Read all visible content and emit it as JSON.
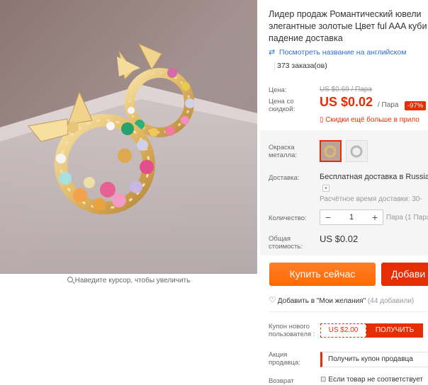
{
  "product": {
    "title_lines": [
      "Лидер продаж Романтический ювели",
      "элегантные золотые Цвет ful AAA куби",
      "падение доставка"
    ],
    "translate_link": "Посмотреть название на английском",
    "orders": "373 заказа(ов)",
    "zoom_hint": "Наведите курсор, чтобы увеличить"
  },
  "pricing": {
    "price_label": "Цена:",
    "old_price": "US $0.69 / Пара",
    "discount_price_label": "Цена со скидкой:",
    "discount_price": "US $0.02",
    "per_unit": "/ Пара",
    "discount_badge": "-97%",
    "app_discount": "Скидки ещё больше в прило"
  },
  "options": {
    "color_label": "Окраска металла:",
    "swatches": [
      {
        "name": "gold",
        "selected": true
      },
      {
        "name": "silver",
        "selected": false
      }
    ],
    "shipping_label": "Доставка:",
    "shipping_value": "Бесплатная доставка в Russia",
    "shipping_time": "Расчётное время доставки: 30-",
    "quantity_label": "Количество:",
    "quantity_value": "1",
    "quantity_minus": "−",
    "quantity_plus": "+",
    "quantity_note": "Пара (1 Пара",
    "total_label": "Общая стоимость:",
    "total_value": "US $0.02"
  },
  "actions": {
    "buy_now": "Купить сейчас",
    "add_to_cart": "Добави",
    "wishlist": "Добавить в \"Мои желания\"",
    "wishlist_count": "(44 добавили)"
  },
  "coupons": {
    "new_user_label": "Купон нового пользователя :",
    "new_user_amount": "US $2.00",
    "new_user_button": "ПОЛУЧИТЬ",
    "seller_promo_label": "Акция продавца:",
    "seller_promo_select": "Получить купон продавца",
    "return_label": "Возврат",
    "return_text": "Если товар не соответствует"
  },
  "colors": {
    "accent": "#e62e04",
    "buy": "#ff6a00",
    "link": "#2e6fd6"
  }
}
